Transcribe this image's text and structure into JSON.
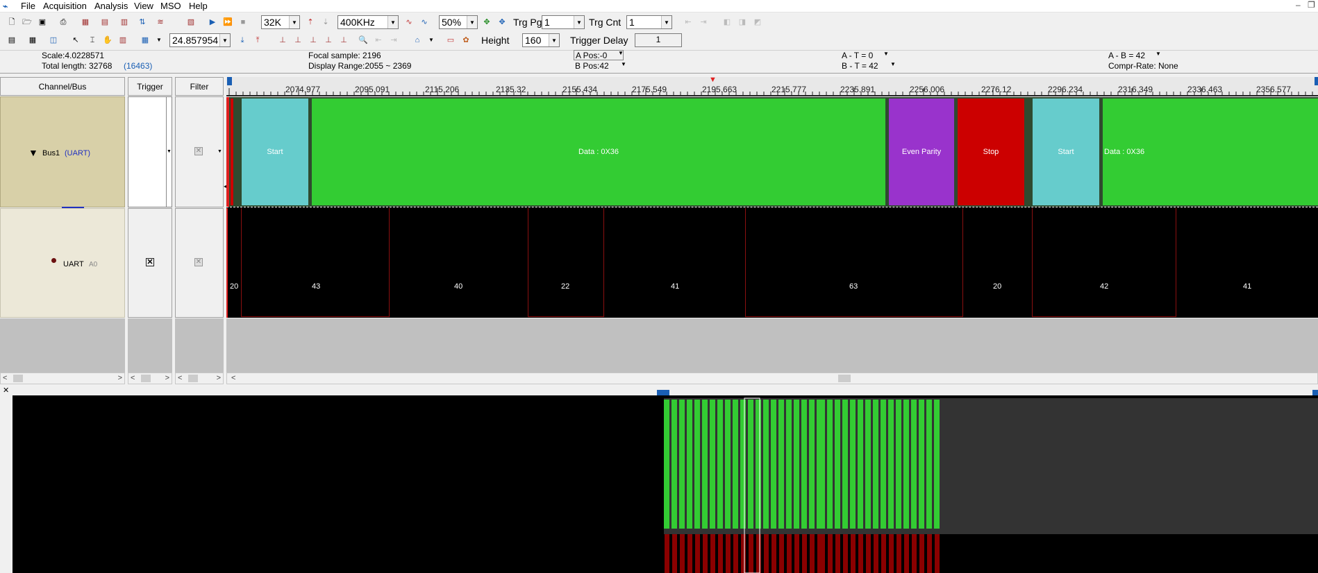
{
  "menu": {
    "items": [
      "File",
      "Acquisition",
      "Analysis",
      "View",
      "MSO",
      "Help"
    ]
  },
  "toolbar1": {
    "depth": "32K",
    "rate": "400KHz",
    "trigger_pos": "50%",
    "trg_pg_label": "Trg Pg",
    "trg_pg_value": "1",
    "trg_cnt_label": "Trg Cnt",
    "trg_cnt_value": "1"
  },
  "toolbar2": {
    "zoom_value": "24.857954",
    "height_label": "Height",
    "height_value": "160",
    "trigger_delay_label": "Trigger Delay",
    "trigger_delay_value": "1"
  },
  "info": {
    "scale": "Scale:4.0228571",
    "total_length": "Total length: 32768",
    "total_length_extra": "(16463)",
    "focal_sample": "Focal sample: 2196",
    "display_range": "Display Range:2055 ~ 2369",
    "a_pos": "A Pos:-0",
    "b_pos": "B Pos:42",
    "a_minus_t": "A - T = 0",
    "b_minus_t": "B - T = 42",
    "a_minus_b": "A - B = 42",
    "compr_rate": "Compr-Rate: None"
  },
  "headers": {
    "channel_bus": "Channel/Bus",
    "trigger": "Trigger",
    "filter": "Filter"
  },
  "bus": {
    "name": "Bus1",
    "type": "(UART)"
  },
  "channel": {
    "name": "UART",
    "pin": "A0"
  },
  "ruler": {
    "ticks": [
      "2074.977",
      "2095.091",
      "2115.206",
      "2135.32",
      "2155.434",
      "2175.549",
      "2195.663",
      "2215.777",
      "2235.891",
      "2256.006",
      "2276.12",
      "2296.234",
      "2316.349",
      "2336.463",
      "2356.577"
    ]
  },
  "decode": [
    {
      "label": "Start",
      "color": "#66cccc"
    },
    {
      "label": "Data : 0X36",
      "color": "#33cc33"
    },
    {
      "label": "Even Parity",
      "color": "#9933cc"
    },
    {
      "label": "Stop",
      "color": "#cc0000"
    },
    {
      "label": "Start",
      "color": "#66cccc"
    },
    {
      "label": "Data : 0X36",
      "color": "#33cc33"
    }
  ],
  "values": [
    "20",
    "43",
    "40",
    "22",
    "41",
    "63",
    "20",
    "42",
    "41"
  ]
}
